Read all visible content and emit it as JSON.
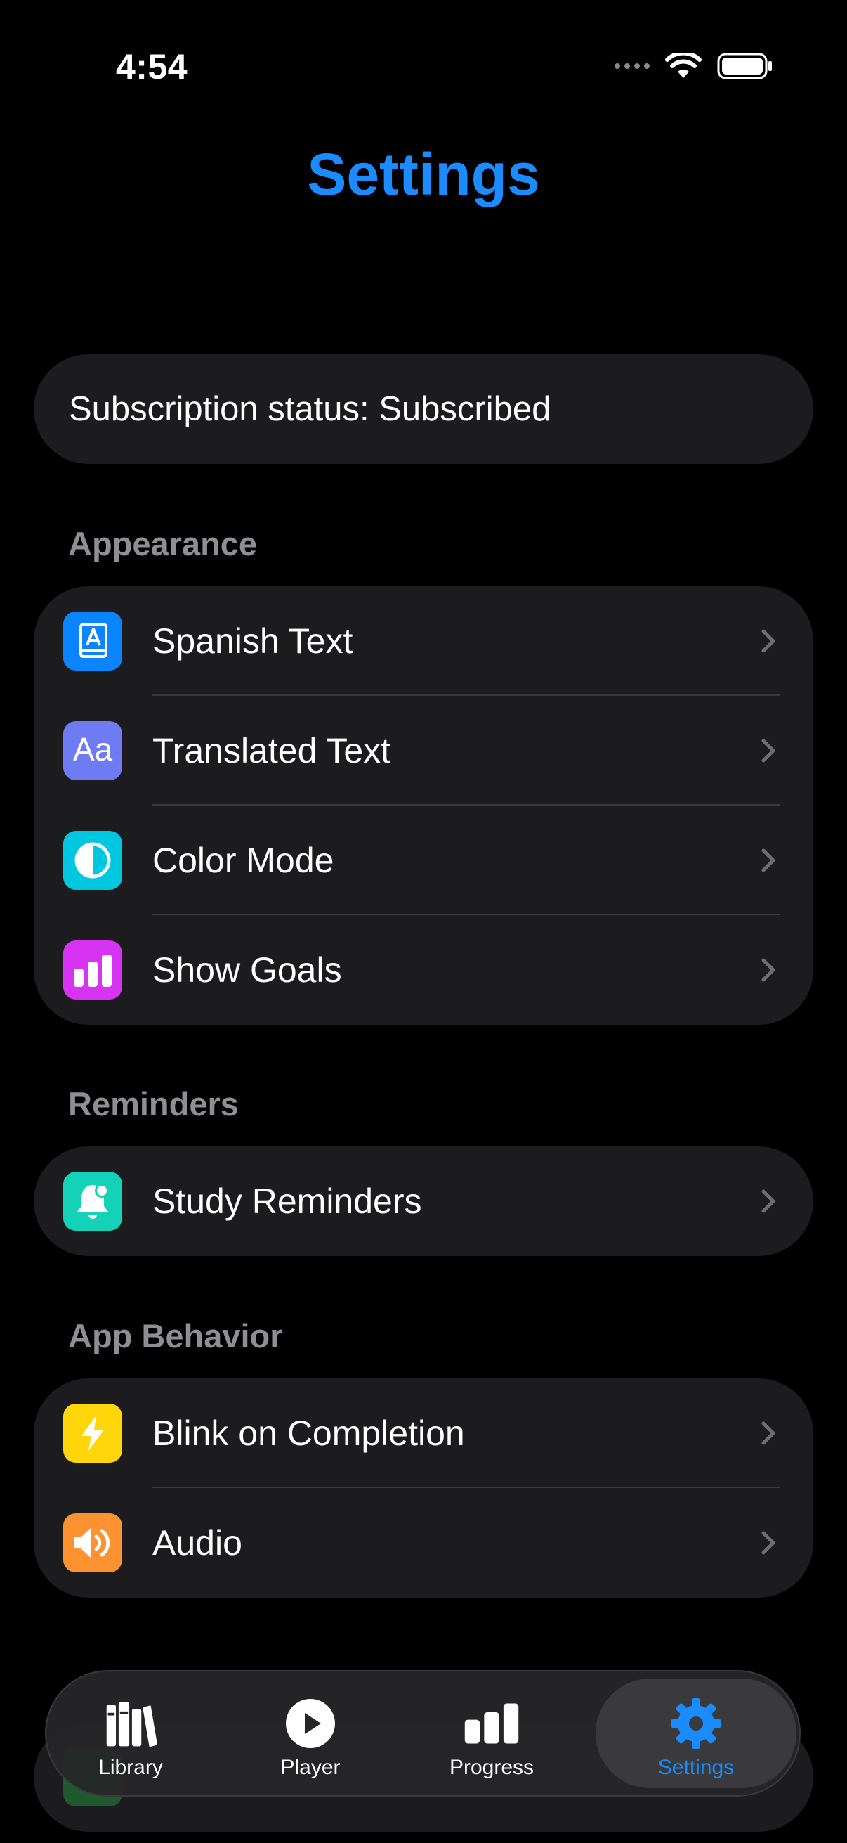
{
  "status_bar": {
    "time": "4:54"
  },
  "title": "Settings",
  "subscription": {
    "text": "Subscription status: Subscribed"
  },
  "sections": {
    "appearance": {
      "header": "Appearance",
      "items": [
        {
          "label": "Spanish Text",
          "icon": "book-a-icon",
          "color": "#0a84ff"
        },
        {
          "label": "Translated Text",
          "icon": "text-aa-icon",
          "color": "#6e7bf2"
        },
        {
          "label": "Color Mode",
          "icon": "contrast-circle-icon",
          "color": "#00c7e0"
        },
        {
          "label": "Show Goals",
          "icon": "bar-chart-icon",
          "color": "#d633f2"
        }
      ]
    },
    "reminders": {
      "header": "Reminders",
      "items": [
        {
          "label": "Study Reminders",
          "icon": "bell-badge-icon",
          "color": "#14d2b8"
        }
      ]
    },
    "app_behavior": {
      "header": "App Behavior",
      "items": [
        {
          "label": "Blink on Completion",
          "icon": "bolt-icon",
          "color": "#ffd60a"
        },
        {
          "label": "Audio",
          "icon": "speaker-wave-icon",
          "color": "#ff9230"
        }
      ]
    }
  },
  "tab_bar": {
    "active": "Settings",
    "accent_color": "#1a8cff",
    "tabs": [
      {
        "label": "Library",
        "icon": "books-icon"
      },
      {
        "label": "Player",
        "icon": "play-circle-icon"
      },
      {
        "label": "Progress",
        "icon": "bar-chart-icon"
      },
      {
        "label": "Settings",
        "icon": "gear-icon"
      }
    ]
  }
}
